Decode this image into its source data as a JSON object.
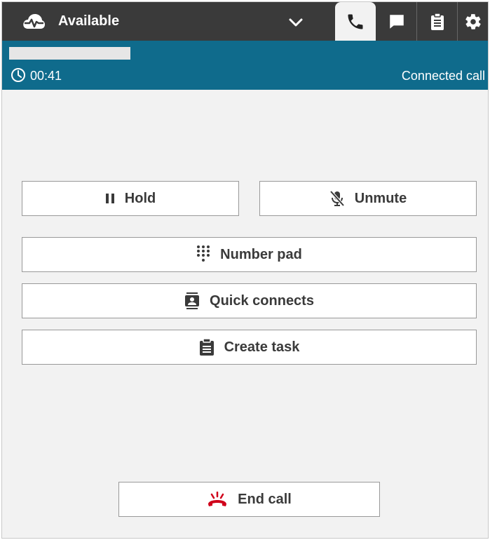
{
  "header": {
    "status_label": "Available",
    "status_icon": "cloud-heartbeat-icon",
    "tabs": [
      {
        "name": "phone",
        "icon": "phone-icon",
        "active": true
      },
      {
        "name": "chat",
        "icon": "chat-icon",
        "active": false
      },
      {
        "name": "tasks",
        "icon": "clipboard-icon",
        "active": false
      },
      {
        "name": "settings",
        "icon": "gear-icon",
        "active": false
      }
    ]
  },
  "call": {
    "timer": "00:41",
    "state": "Connected call"
  },
  "actions": {
    "hold_label": "Hold",
    "unmute_label": "Unmute",
    "number_pad_label": "Number pad",
    "quick_connects_label": "Quick connects",
    "create_task_label": "Create task",
    "end_call_label": "End call"
  },
  "colors": {
    "topbar": "#3a3a3a",
    "callbar": "#0f6b8c",
    "end_call_icon": "#d0021b",
    "background": "#f2f2f2"
  }
}
